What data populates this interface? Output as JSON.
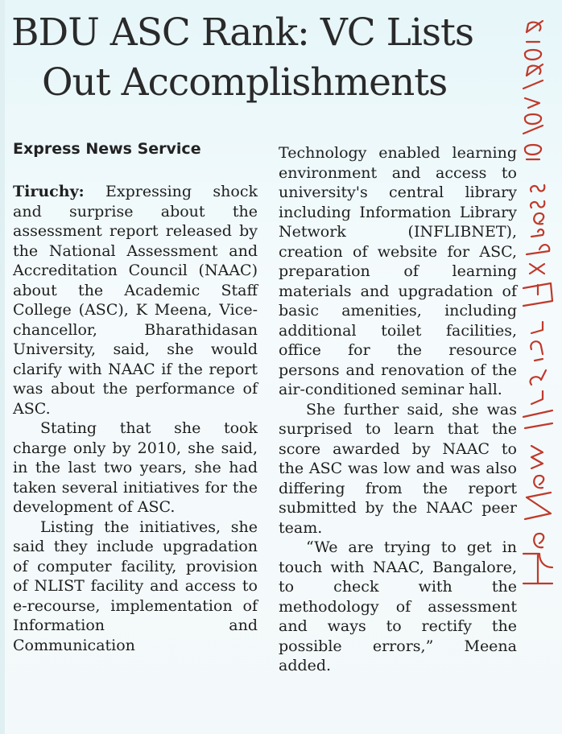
{
  "article": {
    "headline_line1": "BDU ASC Rank: VC Lists",
    "headline_line2": "Out Accomplishments",
    "byline": "Express News Service",
    "dateline": "Tiruchy:",
    "left_para1_rest": " Expressing shock and surprise about the assessment report released by the National Assessment and Accreditation Council (NAAC) about the Academic Staff College (ASC), K Meena, Vice-chancellor, Bharathidasan University, said, she would clarify with NAAC if the report was about the performance of ASC.",
    "left_para2": "Stating that she took charge only by 2010, she said, in the last two years, she had taken several initiatives for the development of ASC.",
    "left_para3": "Listing the initiatives, she said they include upgradation of computer facility, provision of NLIST facility and access to e-recourse, implementation of Information and Communication",
    "right_para1": "Technology enabled learning environment and access to university's central library including Information Library Network (INFLIBNET), creation of website for ASC, preparation of learning materials and upgradation of basic amenities, including additional toilet facilities, office for the resource persons and renovation of the air-conditioned seminar hall.",
    "right_para2": "She further said, she was surprised to learn that the score awarded by NAAC to the ASC was low and was also differing from the report submitted by the NAAC peer team.",
    "right_para3": "“We are trying to get in touch with NAAC, Bangalore, to check with the methodology of assessment and ways to rectify the possible errors,” Meena added."
  },
  "annotation": {
    "handwritten_date": "10/07/2012",
    "handwritten_source": "The New Indian Express",
    "ink_color": "#c0392b"
  },
  "colors": {
    "paper_tint": "#e6f6f9",
    "text": "#1e1e1e"
  }
}
